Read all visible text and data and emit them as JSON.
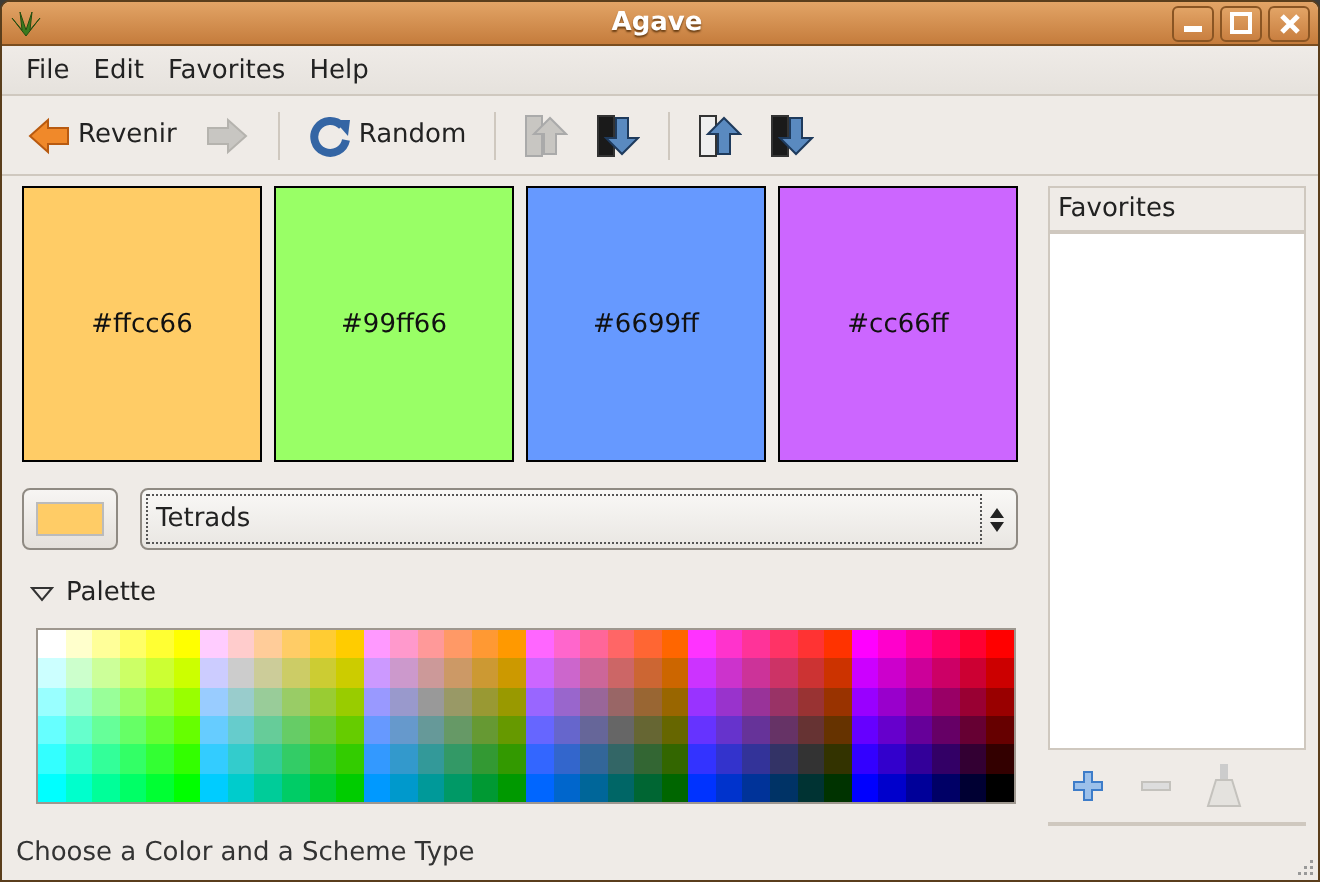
{
  "window": {
    "title": "Agave"
  },
  "menu": [
    {
      "label": "File"
    },
    {
      "label": "Edit"
    },
    {
      "label": "Favorites"
    },
    {
      "label": "Help"
    }
  ],
  "toolbar": [
    {
      "kind": "back",
      "label": "Revenir",
      "disabled": false
    },
    {
      "kind": "forward",
      "disabled": true
    },
    {
      "kind": "separator"
    },
    {
      "kind": "random",
      "label": "Random",
      "disabled": false
    },
    {
      "kind": "separator"
    },
    {
      "kind": "lighten",
      "disabled": true
    },
    {
      "kind": "darken",
      "disabled": false
    },
    {
      "kind": "separator"
    },
    {
      "kind": "saturate",
      "disabled": false
    },
    {
      "kind": "desaturate",
      "disabled": false
    }
  ],
  "swatches": [
    {
      "label": "#ffcc66",
      "color": "#ffcc66"
    },
    {
      "label": "#99ff66",
      "color": "#99ff66"
    },
    {
      "label": "#6699ff",
      "color": "#6699ff"
    },
    {
      "label": "#cc66ff",
      "color": "#cc66ff"
    }
  ],
  "current_color": {
    "color": "#ffcc66"
  },
  "scheme": {
    "value": "Tetrads"
  },
  "palette": {
    "label": "Palette",
    "expanded": true
  },
  "favorites": {
    "heading": "Favorites",
    "buttons": [
      {
        "kind": "add",
        "disabled": false
      },
      {
        "kind": "remove",
        "disabled": true
      },
      {
        "kind": "clear",
        "disabled": true
      }
    ]
  },
  "status_bar": "Choose a Color and a Scheme Type"
}
